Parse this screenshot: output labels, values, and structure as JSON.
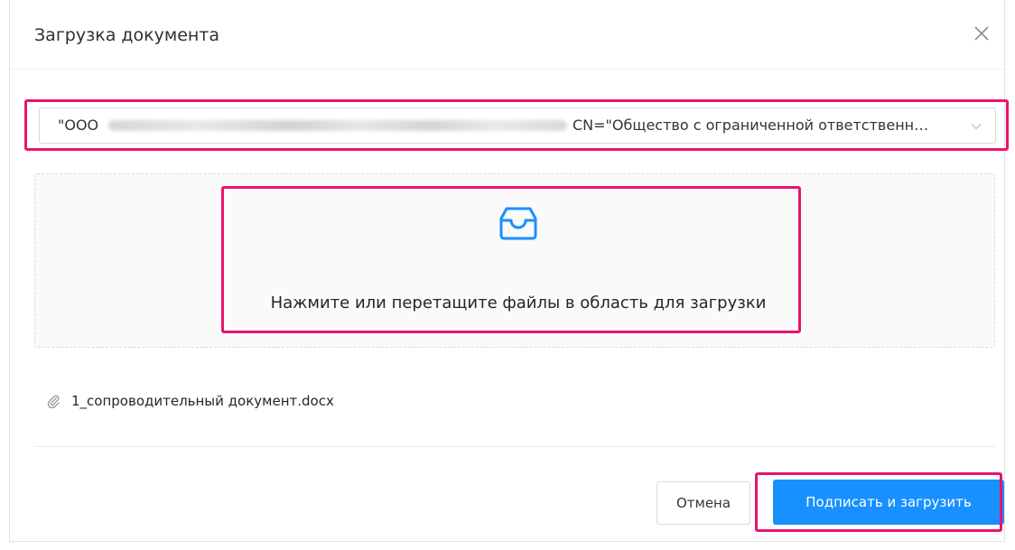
{
  "dialog": {
    "title": "Загрузка документа"
  },
  "certificate": {
    "prefix": "\"ООО",
    "cn_text": "CN=\"Общество с ограниченной ответственн…"
  },
  "upload": {
    "hint": "Нажмите или перетащите файлы в область для загрузки"
  },
  "files": [
    {
      "name": "1_сопроводительный документ.docx"
    }
  ],
  "footer": {
    "cancel_label": "Отмена",
    "submit_label": "Подписать и загрузить"
  },
  "colors": {
    "primary": "#1890ff",
    "highlight": "#e8146c",
    "icon_accent": "#1890ff"
  },
  "icons": {
    "close": "close-icon",
    "chevron": "chevron-down-icon",
    "upload": "inbox-icon",
    "attachment": "paperclip-icon"
  }
}
